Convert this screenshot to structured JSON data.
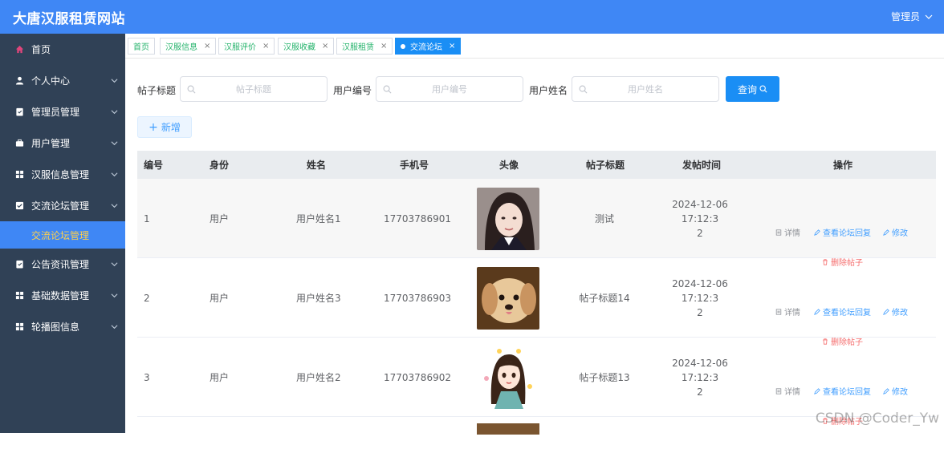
{
  "header": {
    "site_title": "大唐汉服租赁网站",
    "admin_label": "管理员"
  },
  "sidebar": {
    "items": [
      {
        "label": "首页",
        "icon": "home-icon"
      },
      {
        "label": "个人中心",
        "icon": "user-icon"
      },
      {
        "label": "管理员管理",
        "icon": "admin-icon"
      },
      {
        "label": "用户管理",
        "icon": "briefcase-icon"
      },
      {
        "label": "汉服信息管理",
        "icon": "grid-icon"
      },
      {
        "label": "交流论坛管理",
        "icon": "forum-icon"
      },
      {
        "label": "交流论坛管理",
        "sub": true
      },
      {
        "label": "公告资讯管理",
        "icon": "notice-icon"
      },
      {
        "label": "基础数据管理",
        "icon": "database-icon"
      },
      {
        "label": "轮播图信息",
        "icon": "grid-icon"
      }
    ]
  },
  "tags": [
    {
      "label": "首页"
    },
    {
      "label": "汉服信息"
    },
    {
      "label": "汉服评价"
    },
    {
      "label": "汉服收藏"
    },
    {
      "label": "汉服租赁"
    },
    {
      "label": "交流论坛"
    }
  ],
  "search": {
    "title_label": "帖子标题",
    "title_placeholder": "帖子标题",
    "userno_label": "用户编号",
    "userno_placeholder": "用户编号",
    "username_label": "用户姓名",
    "username_placeholder": "用户姓名",
    "query_label": "查询"
  },
  "add_label": "新增",
  "table": {
    "headers": [
      "编号",
      "身份",
      "姓名",
      "手机号",
      "头像",
      "帖子标题",
      "发帖时间",
      "操作"
    ],
    "rows": [
      {
        "no": "1",
        "role": "用户",
        "name": "用户姓名1",
        "phone": "17703786901",
        "title": "测试",
        "time1": "2024-12-06 17:12:3",
        "time2": "2",
        "avatar": "girl-photo"
      },
      {
        "no": "2",
        "role": "用户",
        "name": "用户姓名3",
        "phone": "17703786903",
        "title": "帖子标题14",
        "time1": "2024-12-06 17:12:3",
        "time2": "2",
        "avatar": "puppy-photo"
      },
      {
        "no": "3",
        "role": "用户",
        "name": "用户姓名2",
        "phone": "17703786902",
        "title": "帖子标题13",
        "time1": "2024-12-06 17:12:3",
        "time2": "2",
        "avatar": "cartoon-girl"
      }
    ],
    "ops": {
      "detail": "详情",
      "reply": "查看论坛回复",
      "edit": "修改",
      "delete": "删除帖子"
    }
  },
  "watermark": "CSDN @Coder_Yw",
  "colors": {
    "header": "#3f87f5",
    "sidebar": "#304156",
    "primary": "#1a8ef5",
    "danger": "#f56c6c"
  }
}
